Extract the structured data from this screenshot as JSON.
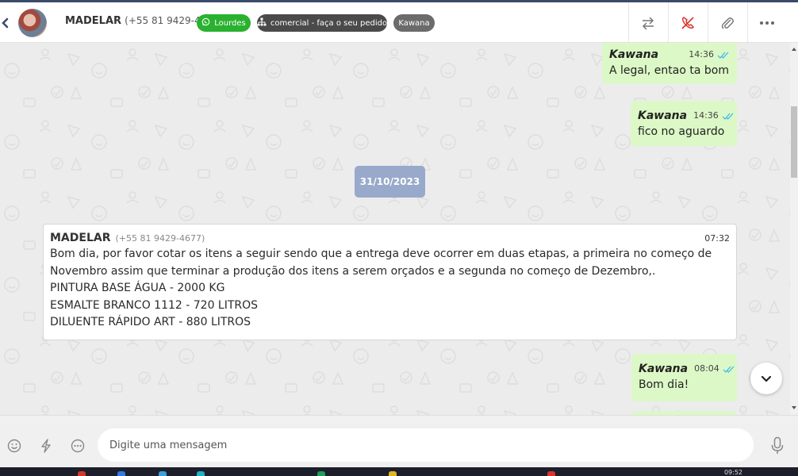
{
  "header": {
    "contact_name": "MADELAR",
    "contact_phone": "(+55 81 9429-4677)",
    "tags": [
      {
        "label": "Lourdes",
        "color": "#2ab12f",
        "icon": "whatsapp-icon"
      },
      {
        "label": "comercial - faça o seu pedido",
        "color": "#4a4a4a",
        "icon": "sitemap-icon"
      },
      {
        "label": "Kawana",
        "color": "#6b6b6b"
      }
    ],
    "actions": [
      "transfer-icon",
      "end-call-icon",
      "attach-icon",
      "more-icon"
    ]
  },
  "messages": {
    "out1": {
      "sender": "Kawana",
      "time": "14:36",
      "text": "A legal, entao ta bom"
    },
    "out2": {
      "sender": "Kawana",
      "time": "14:36",
      "text": "fico no aguardo"
    },
    "date_divider": "31/10/2023",
    "in1": {
      "sender": "MADELAR",
      "phone": "(+55 81 9429-4677)",
      "time": "07:32",
      "lines": [
        "Bom dia, por favor cotar os itens a seguir sendo que a entrega deve ocorrer em duas etapas, a primeira no começo de",
        "Novembro assim que terminar a produção dos itens a serem orçados e a segunda no começo de Dezembro,.",
        "PINTURA BASE ÁGUA - 2000 KG",
        "ESMALTE BRANCO 1112 - 720 LITROS",
        "DILUENTE RÁPIDO ART - 880 LITROS"
      ]
    },
    "out3": {
      "sender": "Kawana",
      "time": "08:04",
      "text": "Bom dia!"
    }
  },
  "composer": {
    "placeholder": "Digite uma mensagem"
  },
  "taskbar": {
    "clock": "09:52"
  },
  "colors": {
    "outgoing_bubble": "#dcf8c6",
    "date_chip": "#98a9cc",
    "read_ticks": "#34b7f1",
    "header_accent": "#3b4a6b"
  }
}
